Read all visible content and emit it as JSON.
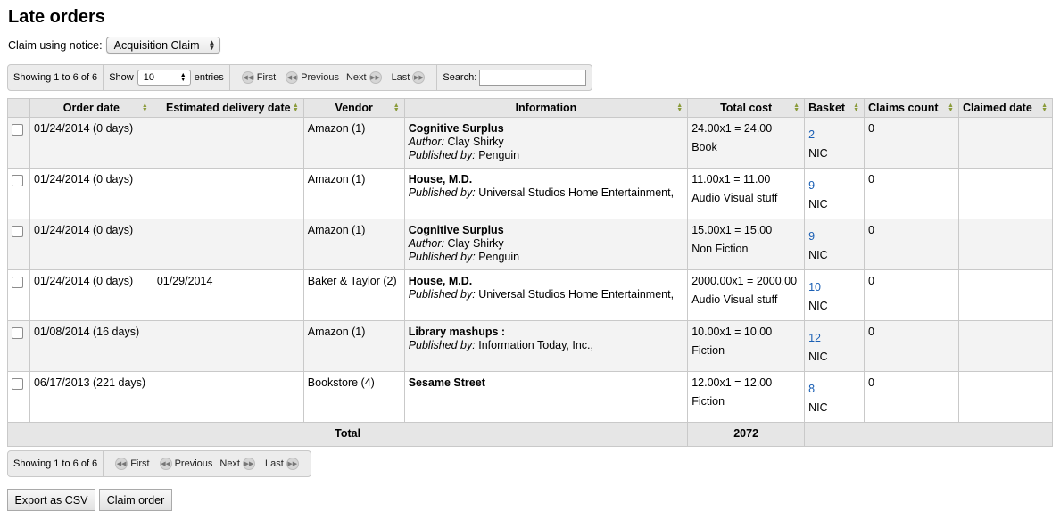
{
  "page": {
    "title": "Late orders"
  },
  "claim": {
    "label": "Claim using notice:",
    "selected": "Acquisition Claim"
  },
  "pager_top": {
    "showing": "Showing 1 to 6 of 6",
    "show_label": "Show",
    "entries_value": "10",
    "entries_label": "entries",
    "first": "First",
    "previous": "Previous",
    "next": "Next",
    "last": "Last",
    "search_label": "Search:",
    "search_value": ""
  },
  "table": {
    "headers": [
      "Order date",
      "Estimated delivery date",
      "Vendor",
      "Information",
      "Total cost",
      "Basket",
      "Claims count",
      "Claimed date"
    ],
    "rows": [
      {
        "order_date": "01/24/2014 (0 days)",
        "est_delivery": "",
        "vendor": "Amazon (1)",
        "info_title": "Cognitive Surplus",
        "author_label": "Author:",
        "author": " Clay Shirky",
        "pub_label": "Published by:",
        "publisher": " Penguin",
        "cost": "24.00x1 = 24.00",
        "fund": "Book",
        "basket": "2",
        "basket_group": "NIC",
        "claims": "0",
        "claimed_date": ""
      },
      {
        "order_date": "01/24/2014 (0 days)",
        "est_delivery": "",
        "vendor": "Amazon (1)",
        "info_title": "House, M.D.",
        "author_label": "",
        "author": "",
        "pub_label": "Published by:",
        "publisher": " Universal Studios Home Entertainment,",
        "cost": "11.00x1 = 11.00",
        "fund": "Audio Visual stuff",
        "basket": "9",
        "basket_group": "NIC",
        "claims": "0",
        "claimed_date": ""
      },
      {
        "order_date": "01/24/2014 (0 days)",
        "est_delivery": "",
        "vendor": "Amazon (1)",
        "info_title": "Cognitive Surplus",
        "author_label": "Author:",
        "author": " Clay Shirky",
        "pub_label": "Published by:",
        "publisher": " Penguin",
        "cost": "15.00x1 = 15.00",
        "fund": "Non Fiction",
        "basket": "9",
        "basket_group": "NIC",
        "claims": "0",
        "claimed_date": ""
      },
      {
        "order_date": "01/24/2014 (0 days)",
        "est_delivery": "01/29/2014",
        "vendor": "Baker & Taylor (2)",
        "info_title": "House, M.D.",
        "author_label": "",
        "author": "",
        "pub_label": "Published by:",
        "publisher": " Universal Studios Home Entertainment,",
        "cost": "2000.00x1 = 2000.00",
        "fund": "Audio Visual stuff",
        "basket": "10",
        "basket_group": "NIC",
        "claims": "0",
        "claimed_date": ""
      },
      {
        "order_date": "01/08/2014 (16 days)",
        "est_delivery": "",
        "vendor": "Amazon (1)",
        "info_title": "Library mashups :",
        "author_label": "",
        "author": "",
        "pub_label": "Published by:",
        "publisher": " Information Today, Inc.,",
        "cost": "10.00x1 = 10.00",
        "fund": "Fiction",
        "basket": "12",
        "basket_group": "NIC",
        "claims": "0",
        "claimed_date": ""
      },
      {
        "order_date": "06/17/2013 (221 days)",
        "est_delivery": "",
        "vendor": "Bookstore (4)",
        "info_title": "Sesame Street",
        "author_label": "",
        "author": "",
        "pub_label": "",
        "publisher": "",
        "cost": "12.00x1 = 12.00",
        "fund": "Fiction",
        "basket": "8",
        "basket_group": "NIC",
        "claims": "0",
        "claimed_date": ""
      }
    ],
    "footer": {
      "label": "Total",
      "total": "2072"
    }
  },
  "pager_bottom": {
    "showing": "Showing 1 to 6 of 6",
    "first": "First",
    "previous": "Previous",
    "next": "Next",
    "last": "Last"
  },
  "actions": {
    "export": "Export as CSV",
    "claim": "Claim order"
  }
}
